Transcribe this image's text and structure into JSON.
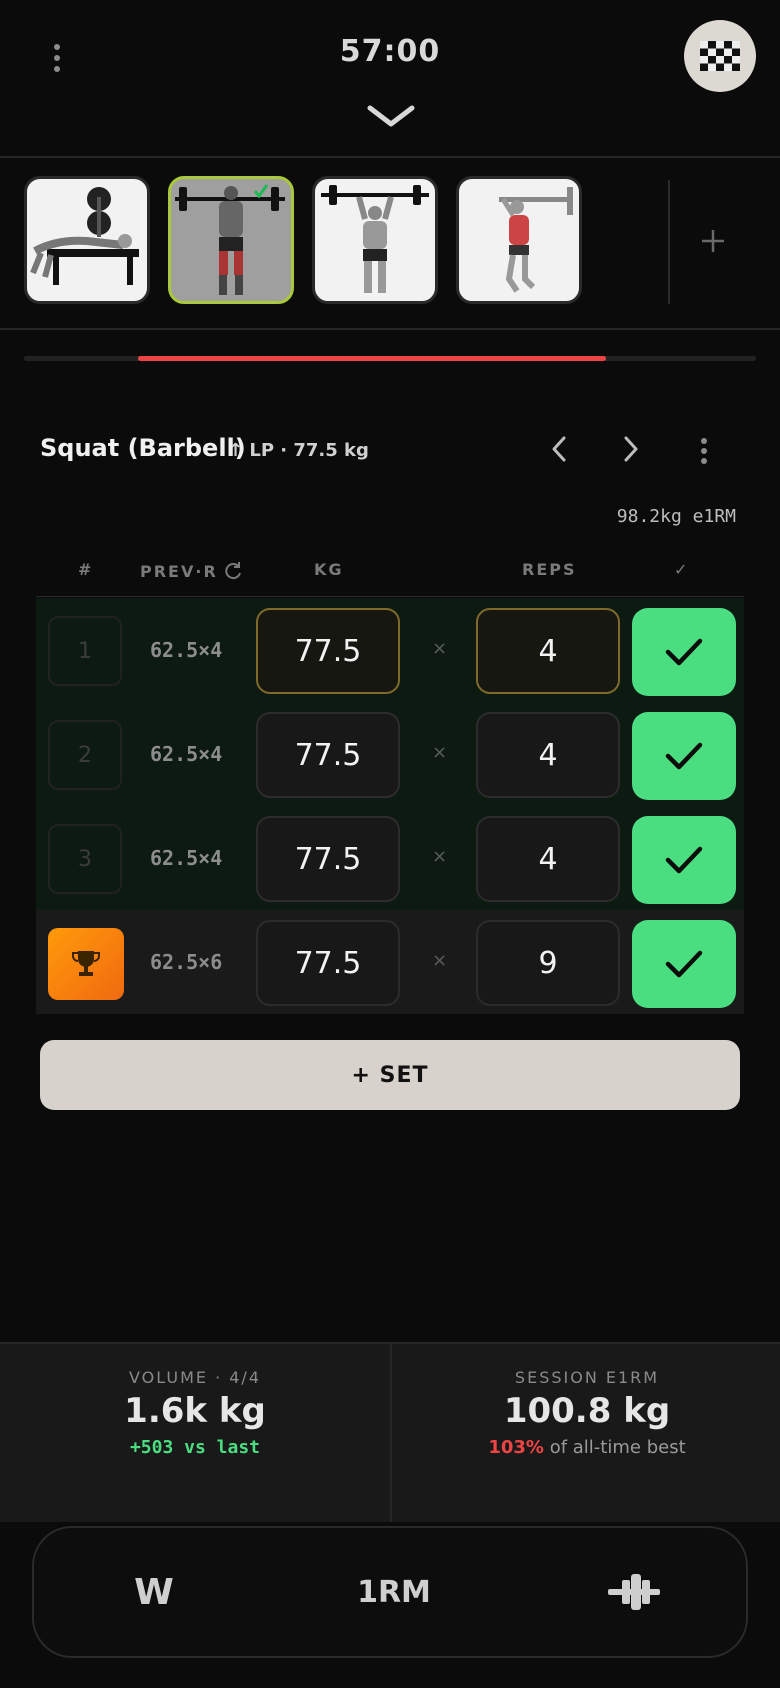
{
  "header": {
    "timer": "57:00"
  },
  "exercise_strip": {
    "thumbnails": [
      {
        "name": "bench-press",
        "active": false
      },
      {
        "name": "squat-barbell",
        "active": true,
        "completed": true
      },
      {
        "name": "overhead-press",
        "active": false
      },
      {
        "name": "pull-up",
        "active": false
      }
    ],
    "progress": 0.64
  },
  "exercise": {
    "title": "Squat (Barbell)",
    "subtitle": "↑ LP · 77.5 kg",
    "e1rm": "98.2kg e1RM"
  },
  "table": {
    "headers": {
      "num": "#",
      "prev": "PREV·R",
      "kg": "KG",
      "reps": "REPS",
      "done": "✓"
    },
    "rows": [
      {
        "num": "1",
        "prev": "62.5×4",
        "kg": "77.5",
        "reps": "4",
        "times": "×",
        "pr": false
      },
      {
        "num": "2",
        "prev": "62.5×4",
        "kg": "77.5",
        "reps": "4",
        "times": "×",
        "pr": false
      },
      {
        "num": "3",
        "prev": "62.5×4",
        "kg": "77.5",
        "reps": "4",
        "times": "×",
        "pr": false
      },
      {
        "num": "",
        "prev": "62.5×6",
        "kg": "77.5",
        "reps": "9",
        "times": "×",
        "pr": true
      }
    ]
  },
  "add_set_label": "+ SET",
  "stats": {
    "volume_label": "VOLUME · 4/4",
    "volume_value": "1.6k kg",
    "volume_delta": "+503 vs last",
    "e1rm_label": "SESSION E1RM",
    "e1rm_value": "100.8 kg",
    "e1rm_pct": "103%",
    "e1rm_foot": "of all-time best"
  },
  "bottom_bar": {
    "warmup": "W",
    "onerm": "1RM",
    "plates_icon": "barbell-plates-icon"
  },
  "colors": {
    "accent_green": "#4ade80",
    "progress_red": "#ee4444",
    "active_border": "#a8c93a",
    "trophy_orange": "#f7850e"
  }
}
